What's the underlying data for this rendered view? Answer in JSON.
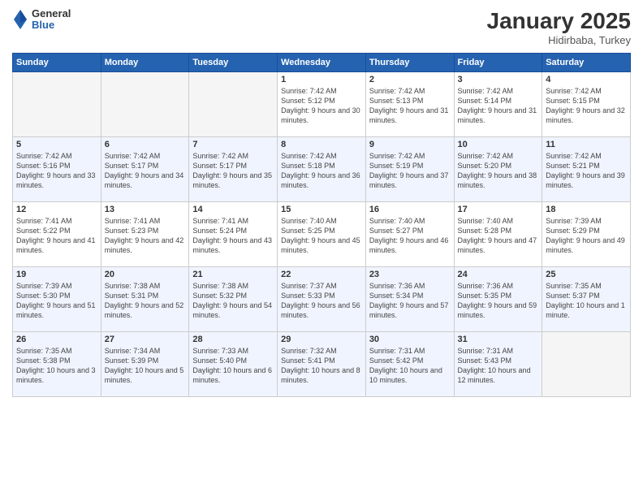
{
  "header": {
    "logo": {
      "general": "General",
      "blue": "Blue"
    },
    "title": "January 2025",
    "location": "Hidirbaba, Turkey"
  },
  "weekdays": [
    "Sunday",
    "Monday",
    "Tuesday",
    "Wednesday",
    "Thursday",
    "Friday",
    "Saturday"
  ],
  "weeks": [
    [
      {
        "day": "",
        "empty": true
      },
      {
        "day": "",
        "empty": true
      },
      {
        "day": "",
        "empty": true
      },
      {
        "day": "1",
        "sunrise": "7:42 AM",
        "sunset": "5:12 PM",
        "daylight": "9 hours and 30 minutes."
      },
      {
        "day": "2",
        "sunrise": "7:42 AM",
        "sunset": "5:13 PM",
        "daylight": "9 hours and 31 minutes."
      },
      {
        "day": "3",
        "sunrise": "7:42 AM",
        "sunset": "5:14 PM",
        "daylight": "9 hours and 31 minutes."
      },
      {
        "day": "4",
        "sunrise": "7:42 AM",
        "sunset": "5:15 PM",
        "daylight": "9 hours and 32 minutes."
      }
    ],
    [
      {
        "day": "5",
        "sunrise": "7:42 AM",
        "sunset": "5:16 PM",
        "daylight": "9 hours and 33 minutes."
      },
      {
        "day": "6",
        "sunrise": "7:42 AM",
        "sunset": "5:17 PM",
        "daylight": "9 hours and 34 minutes."
      },
      {
        "day": "7",
        "sunrise": "7:42 AM",
        "sunset": "5:17 PM",
        "daylight": "9 hours and 35 minutes."
      },
      {
        "day": "8",
        "sunrise": "7:42 AM",
        "sunset": "5:18 PM",
        "daylight": "9 hours and 36 minutes."
      },
      {
        "day": "9",
        "sunrise": "7:42 AM",
        "sunset": "5:19 PM",
        "daylight": "9 hours and 37 minutes."
      },
      {
        "day": "10",
        "sunrise": "7:42 AM",
        "sunset": "5:20 PM",
        "daylight": "9 hours and 38 minutes."
      },
      {
        "day": "11",
        "sunrise": "7:42 AM",
        "sunset": "5:21 PM",
        "daylight": "9 hours and 39 minutes."
      }
    ],
    [
      {
        "day": "12",
        "sunrise": "7:41 AM",
        "sunset": "5:22 PM",
        "daylight": "9 hours and 41 minutes."
      },
      {
        "day": "13",
        "sunrise": "7:41 AM",
        "sunset": "5:23 PM",
        "daylight": "9 hours and 42 minutes."
      },
      {
        "day": "14",
        "sunrise": "7:41 AM",
        "sunset": "5:24 PM",
        "daylight": "9 hours and 43 minutes."
      },
      {
        "day": "15",
        "sunrise": "7:40 AM",
        "sunset": "5:25 PM",
        "daylight": "9 hours and 45 minutes."
      },
      {
        "day": "16",
        "sunrise": "7:40 AM",
        "sunset": "5:27 PM",
        "daylight": "9 hours and 46 minutes."
      },
      {
        "day": "17",
        "sunrise": "7:40 AM",
        "sunset": "5:28 PM",
        "daylight": "9 hours and 47 minutes."
      },
      {
        "day": "18",
        "sunrise": "7:39 AM",
        "sunset": "5:29 PM",
        "daylight": "9 hours and 49 minutes."
      }
    ],
    [
      {
        "day": "19",
        "sunrise": "7:39 AM",
        "sunset": "5:30 PM",
        "daylight": "9 hours and 51 minutes."
      },
      {
        "day": "20",
        "sunrise": "7:38 AM",
        "sunset": "5:31 PM",
        "daylight": "9 hours and 52 minutes."
      },
      {
        "day": "21",
        "sunrise": "7:38 AM",
        "sunset": "5:32 PM",
        "daylight": "9 hours and 54 minutes."
      },
      {
        "day": "22",
        "sunrise": "7:37 AM",
        "sunset": "5:33 PM",
        "daylight": "9 hours and 56 minutes."
      },
      {
        "day": "23",
        "sunrise": "7:36 AM",
        "sunset": "5:34 PM",
        "daylight": "9 hours and 57 minutes."
      },
      {
        "day": "24",
        "sunrise": "7:36 AM",
        "sunset": "5:35 PM",
        "daylight": "9 hours and 59 minutes."
      },
      {
        "day": "25",
        "sunrise": "7:35 AM",
        "sunset": "5:37 PM",
        "daylight": "10 hours and 1 minute."
      }
    ],
    [
      {
        "day": "26",
        "sunrise": "7:35 AM",
        "sunset": "5:38 PM",
        "daylight": "10 hours and 3 minutes."
      },
      {
        "day": "27",
        "sunrise": "7:34 AM",
        "sunset": "5:39 PM",
        "daylight": "10 hours and 5 minutes."
      },
      {
        "day": "28",
        "sunrise": "7:33 AM",
        "sunset": "5:40 PM",
        "daylight": "10 hours and 6 minutes."
      },
      {
        "day": "29",
        "sunrise": "7:32 AM",
        "sunset": "5:41 PM",
        "daylight": "10 hours and 8 minutes."
      },
      {
        "day": "30",
        "sunrise": "7:31 AM",
        "sunset": "5:42 PM",
        "daylight": "10 hours and 10 minutes."
      },
      {
        "day": "31",
        "sunrise": "7:31 AM",
        "sunset": "5:43 PM",
        "daylight": "10 hours and 12 minutes."
      },
      {
        "day": "",
        "empty": true
      }
    ]
  ],
  "labels": {
    "sunrise": "Sunrise:",
    "sunset": "Sunset:",
    "daylight": "Daylight:"
  }
}
